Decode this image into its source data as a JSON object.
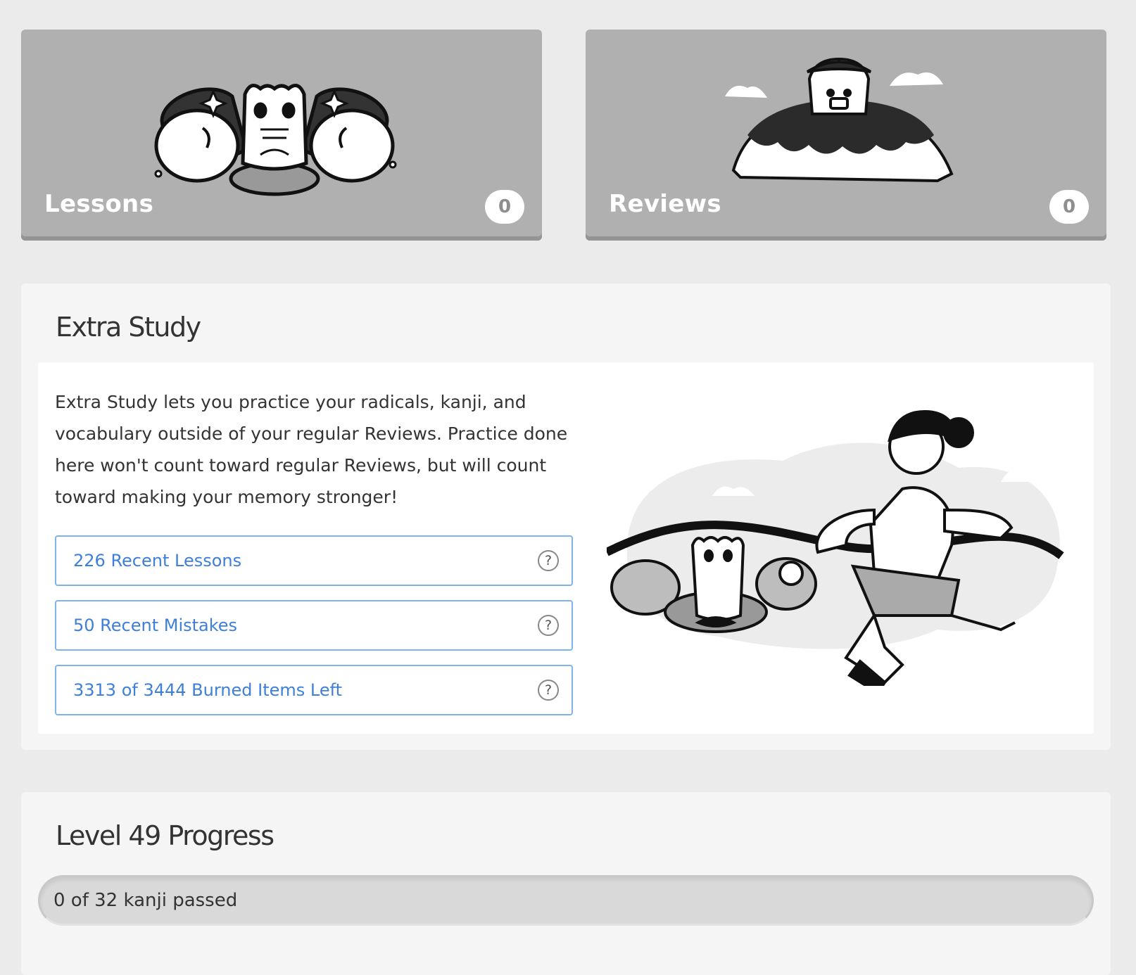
{
  "lessons": {
    "title": "Lessons",
    "count": "0"
  },
  "reviews": {
    "title": "Reviews",
    "count": "0"
  },
  "extra_study": {
    "heading": "Extra Study",
    "description": "Extra Study lets you practice your radicals, kanji, and vocabulary outside of your regular Reviews. Practice done here won't count toward regular Reviews, but will count toward making your memory stronger!",
    "buttons": [
      {
        "label": "226 Recent Lessons",
        "help": "?"
      },
      {
        "label": "50 Recent Mistakes",
        "help": "?"
      },
      {
        "label": "3313 of 3444 Burned Items Left",
        "help": "?"
      }
    ]
  },
  "level_progress": {
    "heading": "Level 49 Progress",
    "bar_label": "0 of 32 kanji passed",
    "passed": 0,
    "total": 32
  }
}
